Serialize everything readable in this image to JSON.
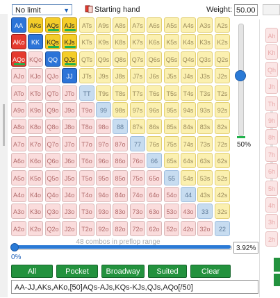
{
  "toolbar": {
    "limit_select": "No limit",
    "starting_hand_label": "Starting hand",
    "weight_label": "Weight:",
    "weight_value": "50.00"
  },
  "ranks": [
    "A",
    "K",
    "Q",
    "J",
    "T",
    "9",
    "8",
    "7",
    "6",
    "5",
    "4",
    "3",
    "2"
  ],
  "selection": {
    "pairs_full": [
      "AA",
      "KK",
      "QQ",
      "JJ"
    ],
    "suited_full": [
      "AKs"
    ],
    "suited_half": [
      "AQs",
      "AJs",
      "KQs",
      "KJs",
      "QJs"
    ],
    "offsuit_full": [
      "AKo"
    ],
    "offsuit_half": [
      "AQo"
    ]
  },
  "vertical_slider": {
    "percent_label": "50%"
  },
  "horizontal_slider": {
    "combos_label": "48 combos in preflop range",
    "min_label": "0%",
    "percent_value": "3.92%"
  },
  "buttons": [
    {
      "label": "All"
    },
    {
      "label": "Pocket"
    },
    {
      "label": "Broadway"
    },
    {
      "label": "Suited"
    },
    {
      "label": "Clear"
    }
  ],
  "range_text": "AA-JJ,AKs,AKo,[50]AQs-AJs,KQs-KJs,QJs,AQo[/50]",
  "right_column": [
    "Ah",
    "Kh",
    "Qh",
    "Jh",
    "Th",
    "9h",
    "8h",
    "7h",
    "6h",
    "5h",
    "4h",
    "3h",
    "2h"
  ],
  "colors": {
    "accent_blue": "#2c74d8",
    "suited_yellow": "#f4cd2a",
    "offsuit_red": "#e53a2e",
    "button_green": "#23923e"
  },
  "icons": [
    "dropdown-arrow-icon",
    "cards-icon"
  ]
}
